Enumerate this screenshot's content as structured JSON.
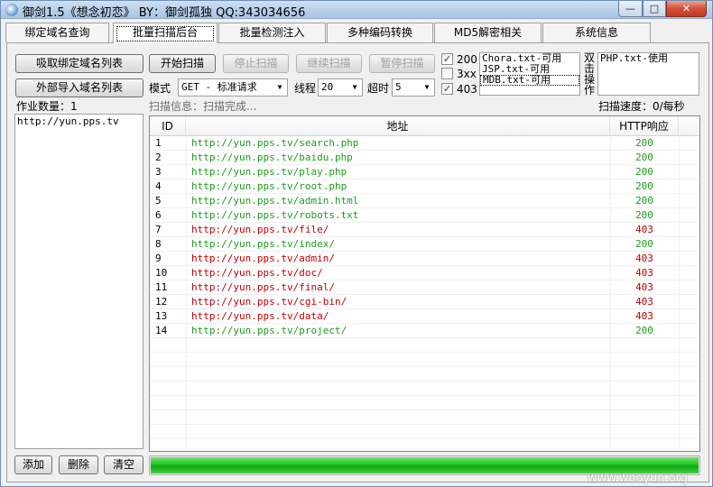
{
  "window": {
    "title": "御剑1.5《想念初恋》 BY：御剑孤独 QQ:343034656",
    "min_glyph": "—",
    "max_glyph": "□",
    "close_glyph": "✕"
  },
  "tabs": [
    "绑定域名查询",
    "批量扫描后台",
    "批量检测注入",
    "多种编码转换",
    "MD5解密相关",
    "系统信息"
  ],
  "left": {
    "fetch_button": "吸取绑定域名列表",
    "import_button": "外部导入域名列表",
    "job_count_label": "作业数量：1",
    "domains": [
      "http://yun.pps.tv"
    ],
    "add_button": "添加",
    "delete_button": "删除",
    "clear_button": "清空"
  },
  "toolbar": {
    "start": "开始扫描",
    "stop": "停止扫描",
    "resume": "继续扫描",
    "pause": "暂停扫描",
    "mode_label": "模式",
    "mode_value": "GET - 标准请求",
    "threads_label": "线程",
    "threads_value": "20",
    "timeout_label": "超时",
    "timeout_value": "5"
  },
  "status_filters": [
    {
      "label": "200",
      "checked": "✓"
    },
    {
      "label": "3xx",
      "checked": ""
    },
    {
      "label": "403",
      "checked": "✓"
    }
  ],
  "dictionaries": [
    "Chora.txt-可用",
    "JSP.txt-可用",
    "MDB.txt-可用"
  ],
  "dbl_click_hint": [
    "双",
    "击",
    "操",
    "作"
  ],
  "php_dict": [
    "PHP.txt-使用"
  ],
  "scan_info": "扫描信息：扫描完成...",
  "scan_speed": "扫描速度：0/每秒",
  "table": {
    "headers": [
      "ID",
      "地址",
      "HTTP响应"
    ],
    "rows": [
      {
        "id": "1",
        "url": "http://yun.pps.tv/search.php",
        "code": "200"
      },
      {
        "id": "2",
        "url": "http://yun.pps.tv/baidu.php",
        "code": "200"
      },
      {
        "id": "3",
        "url": "http://yun.pps.tv/play.php",
        "code": "200"
      },
      {
        "id": "4",
        "url": "http://yun.pps.tv/root.php",
        "code": "200"
      },
      {
        "id": "5",
        "url": "http://yun.pps.tv/admin.html",
        "code": "200"
      },
      {
        "id": "6",
        "url": "http://yun.pps.tv/robots.txt",
        "code": "200"
      },
      {
        "id": "7",
        "url": "http://yun.pps.tv/file/",
        "code": "403"
      },
      {
        "id": "8",
        "url": "http://yun.pps.tv/index/",
        "code": "200"
      },
      {
        "id": "9",
        "url": "http://yun.pps.tv/admin/",
        "code": "403"
      },
      {
        "id": "10",
        "url": "http://yun.pps.tv/doc/",
        "code": "403"
      },
      {
        "id": "11",
        "url": "http://yun.pps.tv/final/",
        "code": "403"
      },
      {
        "id": "12",
        "url": "http://yun.pps.tv/cgi-bin/",
        "code": "403"
      },
      {
        "id": "13",
        "url": "http://yun.pps.tv/data/",
        "code": "403"
      },
      {
        "id": "14",
        "url": "http://yun.pps.tv/project/",
        "code": "200"
      }
    ]
  },
  "progress": 1.0,
  "colors": {
    "ok": "#1e9a1e",
    "forbidden": "#c00000"
  },
  "watermark": "www.wooyun.org"
}
